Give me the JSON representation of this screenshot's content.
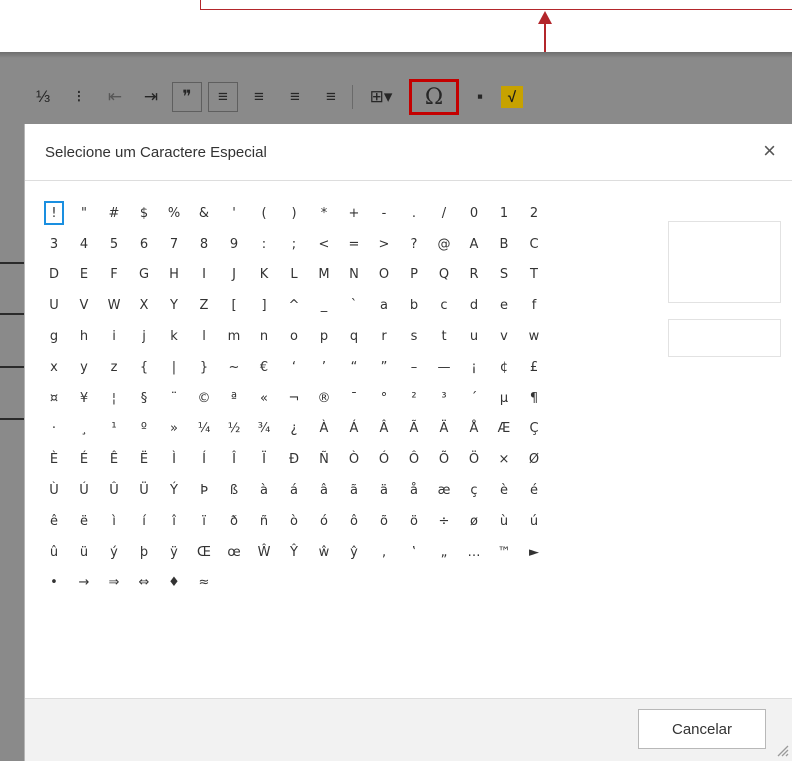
{
  "toolbar": {
    "buttons": [
      {
        "name": "ordered-list-icon",
        "glyph": "⅓"
      },
      {
        "name": "bulleted-list-icon",
        "glyph": "⁝"
      },
      {
        "name": "outdent-icon",
        "glyph": "⇤"
      },
      {
        "name": "indent-icon",
        "glyph": "⇥"
      },
      {
        "name": "blockquote-icon",
        "glyph": "❞"
      },
      {
        "name": "align-left-icon",
        "glyph": "≡"
      },
      {
        "name": "align-center-icon",
        "glyph": "≡"
      },
      {
        "name": "align-right-icon",
        "glyph": "≡"
      },
      {
        "name": "justify-icon",
        "glyph": "≡"
      },
      {
        "name": "table-icon",
        "glyph": "⊞▾"
      },
      {
        "name": "special-character-icon",
        "glyph": "Ω"
      },
      {
        "name": "image-icon",
        "glyph": "▪"
      },
      {
        "name": "math-formula-icon",
        "glyph": "√"
      }
    ]
  },
  "dialog": {
    "title": "Selecione um Caractere Especial",
    "close_glyph": "×",
    "cancel_label": "Cancelar"
  },
  "characters": [
    "!",
    "\"",
    "#",
    "$",
    "%",
    "&",
    "'",
    "(",
    ")",
    "*",
    "+",
    "-",
    ".",
    "/",
    "0",
    "1",
    "2",
    "3",
    "4",
    "5",
    "6",
    "7",
    "8",
    "9",
    ":",
    ";",
    "<",
    "=",
    ">",
    "?",
    "@",
    "A",
    "B",
    "C",
    "D",
    "E",
    "F",
    "G",
    "H",
    "I",
    "J",
    "K",
    "L",
    "M",
    "N",
    "O",
    "P",
    "Q",
    "R",
    "S",
    "T",
    "U",
    "V",
    "W",
    "X",
    "Y",
    "Z",
    "[",
    "]",
    "^",
    "_",
    "`",
    "a",
    "b",
    "c",
    "d",
    "e",
    "f",
    "g",
    "h",
    "i",
    "j",
    "k",
    "l",
    "m",
    "n",
    "o",
    "p",
    "q",
    "r",
    "s",
    "t",
    "u",
    "v",
    "w",
    "x",
    "y",
    "z",
    "{",
    "|",
    "}",
    "~",
    "€",
    "‘",
    "’",
    "“",
    "”",
    "–",
    "—",
    "¡",
    "¢",
    "£",
    "¤",
    "¥",
    "¦",
    "§",
    "¨",
    "©",
    "ª",
    "«",
    "¬",
    "®",
    "¯",
    "°",
    "²",
    "³",
    "´",
    "µ",
    "¶",
    "·",
    "¸",
    "¹",
    "º",
    "»",
    "¼",
    "½",
    "¾",
    "¿",
    "À",
    "Á",
    "Â",
    "Ã",
    "Ä",
    "Å",
    "Æ",
    "Ç",
    "È",
    "É",
    "Ê",
    "Ë",
    "Ì",
    "Í",
    "Î",
    "Ï",
    "Ð",
    "Ñ",
    "Ò",
    "Ó",
    "Ô",
    "Õ",
    "Ö",
    "×",
    "Ø",
    "Ù",
    "Ú",
    "Û",
    "Ü",
    "Ý",
    "Þ",
    "ß",
    "à",
    "á",
    "â",
    "ã",
    "ä",
    "å",
    "æ",
    "ç",
    "è",
    "é",
    "ê",
    "ë",
    "ì",
    "í",
    "î",
    "ï",
    "ð",
    "ñ",
    "ò",
    "ó",
    "ô",
    "õ",
    "ö",
    "÷",
    "ø",
    "ù",
    "ú",
    "û",
    "ü",
    "ý",
    "þ",
    "ÿ",
    "Œ",
    "œ",
    "Ŵ",
    "Ŷ",
    "ŵ",
    "ŷ",
    "‚",
    "‛",
    "„",
    "…",
    "™",
    "►",
    "•",
    "→",
    "⇒",
    "⇔",
    "♦",
    "≈"
  ],
  "selected_character": "!",
  "colors": {
    "annotation": "#b3262b",
    "selection": "#1a8fe0",
    "highlight": "#c40000"
  }
}
